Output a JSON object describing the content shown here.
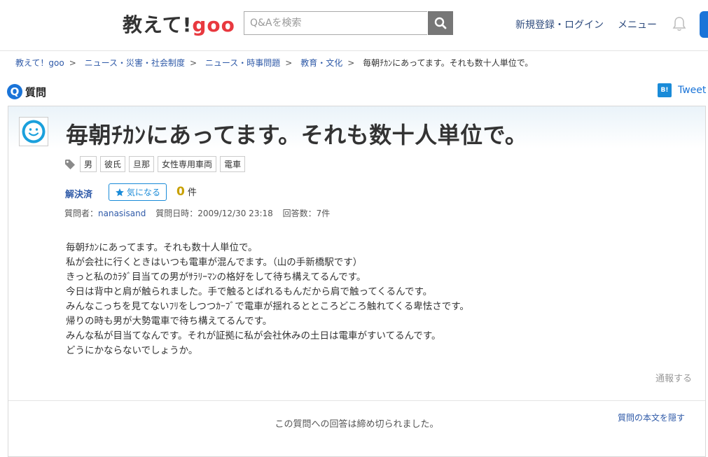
{
  "header": {
    "logo_text": "教えて!",
    "logo_brand": "goo",
    "search_placeholder": "Q&Aを検索",
    "login_label": "新規登録・ログイン",
    "menu_label": "メニュー"
  },
  "breadcrumb": {
    "items": [
      "教えて！goo",
      "ニュース・災害・社会制度",
      "ニュース・時事問題",
      "教育・文化"
    ],
    "current": "毎朝ﾁｶﾝにあってます。それも数十人単位で。"
  },
  "section": {
    "q_badge": "Q",
    "q_label": "質問",
    "tweet_label": "Tweet",
    "hatena_label": "B!"
  },
  "question": {
    "title": "毎朝ﾁｶﾝにあってます。それも数十人単位で。",
    "tags": [
      "男",
      "彼氏",
      "旦那",
      "女性専用車両",
      "電車"
    ],
    "status": "解決済",
    "fav_label": "気になる",
    "fav_count": "0",
    "fav_unit": "件",
    "meta": {
      "asker_label": "質問者：",
      "asker": "nanasisand",
      "date_label": "質問日時：",
      "date": "2009/12/30 23:18",
      "answers_label": "回答数：",
      "answers": "7件"
    },
    "body": [
      "毎朝ﾁｶﾝにあってます。それも数十人単位で。",
      "私が会社に行くときはいつも電車が混んでます。（山の手新橋駅です）",
      "きっと私のｶﾗﾀﾞ目当ての男がｻﾗﾘｰﾏﾝの格好をして待ち構えてるんです。",
      "今日は背中と肩が触られました。手で触るとばれるもんだから肩で触ってくるんです。",
      "みんなこっちを見てないﾌﾘをしつつｶｰﾌﾞで電車が揺れるとところどころ触れてくる卑怯さです。",
      "帰りの時も男が大勢電車で待ち構えてるんです。",
      "みんな私が目当てなんです。それが証拠に私が会社休みの土日は電車がすいてるんです。",
      "どうにかならないでしょうか。"
    ],
    "report_label": "通報する",
    "closed_message": "この質問への回答は締め切られました。",
    "hide_body_label": "質問の本文を隠す"
  },
  "colors": {
    "accent": "#1a74d8",
    "brand_red": "#e8393f",
    "link": "#2f5aa8",
    "count": "#c8a000"
  }
}
